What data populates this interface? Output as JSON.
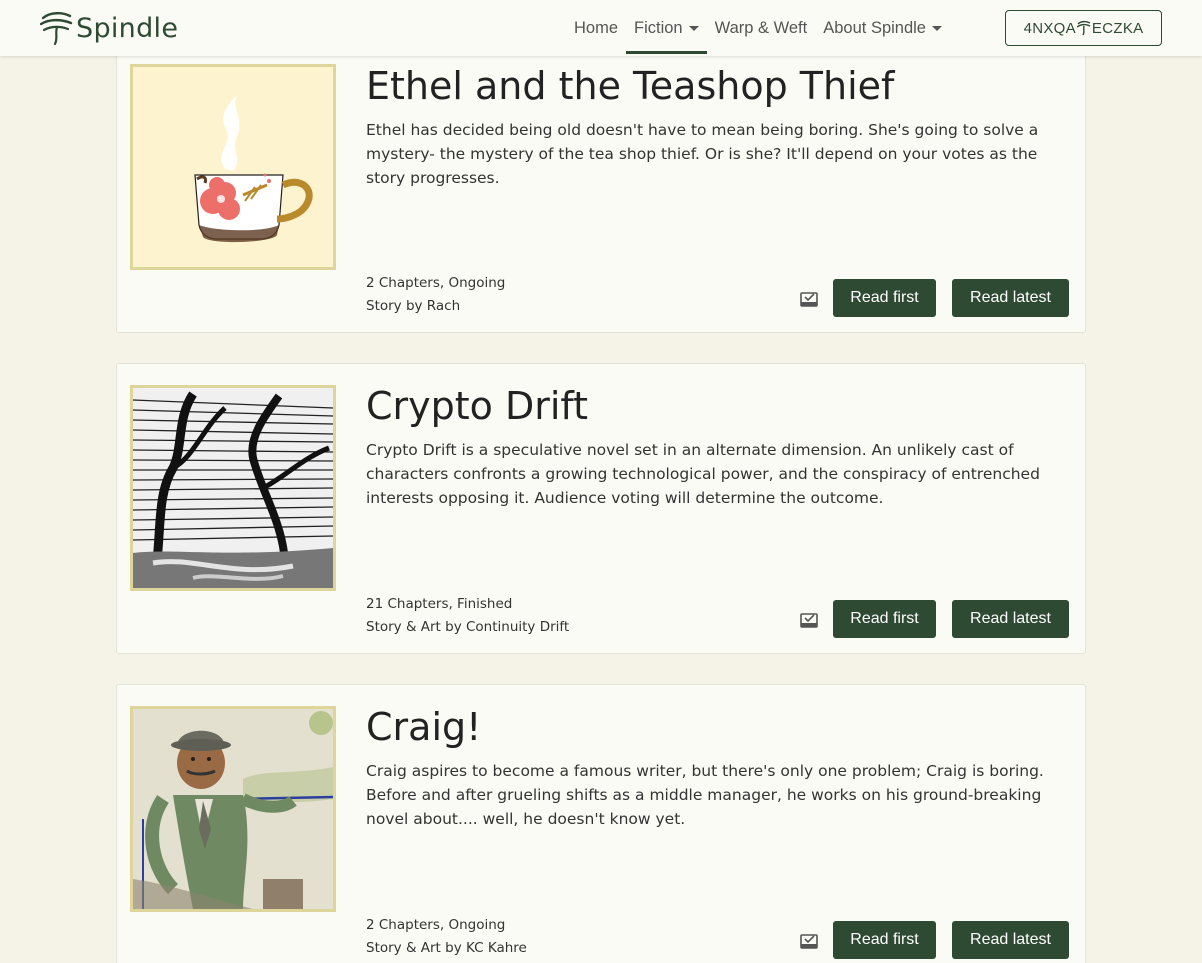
{
  "brand": {
    "name": "Spindle"
  },
  "nav": {
    "home": "Home",
    "fiction": "Fiction",
    "warp": "Warp & Weft",
    "about": "About Spindle",
    "account_left": "4NXQA",
    "account_right": "ECZKA"
  },
  "colors": {
    "accent": "#2e4a33",
    "background": "#f5f3e7",
    "card": "#fbfbf6",
    "cover_border": "#ddd59a"
  },
  "stories": [
    {
      "title": "Ethel and the Teashop Thief",
      "description": "Ethel has decided being old doesn't have to mean being boring. She's going to solve a mystery- the mystery of the tea shop thief. Or is she? It'll depend on your votes as the story progresses.",
      "status": "2 Chapters, Ongoing",
      "credit": "Story by Rach",
      "read_first": "Read first",
      "read_latest": "Read latest",
      "cover_icon": "teacup-illustration"
    },
    {
      "title": "Crypto Drift",
      "description": "Crypto Drift is a speculative novel set in an alternate dimension. An unlikely cast of characters confronts a growing technological power, and the conspiracy of entrenched interests opposing it. Audience voting will determine the outcome.",
      "status": "21 Chapters, Finished",
      "credit": "Story & Art by Continuity Drift",
      "read_first": "Read first",
      "read_latest": "Read latest",
      "cover_icon": "ink-trees-illustration"
    },
    {
      "title": "Craig!",
      "description": "Craig aspires to become a famous writer, but there's only one problem; Craig is boring. Before and after grueling shifts as a middle manager, he works on his ground-breaking novel about.... well, he doesn't know yet.",
      "status": "2 Chapters, Ongoing",
      "credit": "Story & Art by KC Kahre",
      "read_first": "Read first",
      "read_latest": "Read latest",
      "cover_icon": "man-portrait-illustration"
    }
  ]
}
